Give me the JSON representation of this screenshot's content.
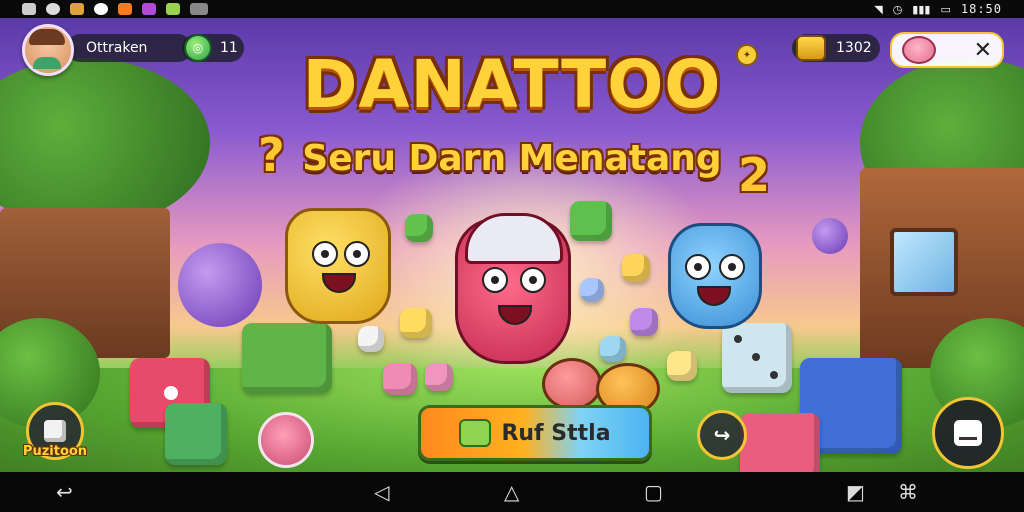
{
  "status_bar": {
    "clock": "18:50",
    "left_icons": [
      "app-icon",
      "chat-icon",
      "game-icon",
      "mascot-icon",
      "orange-app-icon",
      "video-icon",
      "leaf-icon",
      "music-icon"
    ],
    "right_icons": [
      "wifi-icon",
      "alarm-icon",
      "signal-icon",
      "battery-icon"
    ]
  },
  "hud": {
    "player_name": "Ottraken",
    "gems": "11",
    "coins": "1302",
    "star_icon": "star-icon",
    "shop_icon": "pig-icon",
    "close_icon": "close-icon"
  },
  "title": {
    "main": "DANATTOO",
    "subtitle": "Seru Darn Menatang",
    "deco_left": "?",
    "deco_right": "2"
  },
  "buttons": {
    "puzzle_label": "Puzitoon",
    "play_label": "Ruf Sttla",
    "arrow_glyph": "↪"
  },
  "navbar": {
    "back": "↩",
    "back2": "◁",
    "home": "△",
    "recent": "▢",
    "screenshot": "◩",
    "gesture": "⌘"
  },
  "colors": {
    "title_fill": "#ffd23a",
    "title_outline": "#7a3006",
    "accent_gold": "#f3c533",
    "play_orange": "#ff8a1f",
    "play_blue": "#4bb4f0"
  }
}
